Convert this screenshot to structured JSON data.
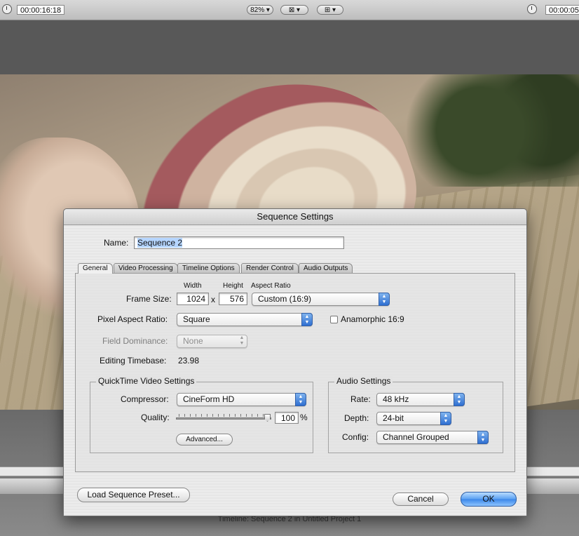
{
  "viewer": {
    "left_timecode": "00:00:16:18",
    "zoom": "82%",
    "view_menu_icon": "view-icon",
    "overlay_menu_icon": "overlay-icon",
    "right_timecode": "00:00:05"
  },
  "timeline_title": "Timeline: Sequence 2 in Untitled Project 1",
  "dialog": {
    "title": "Sequence Settings",
    "name_label": "Name:",
    "name_value": "Sequence 2",
    "tabs": [
      {
        "label": "General"
      },
      {
        "label": "Video Processing"
      },
      {
        "label": "Timeline Options"
      },
      {
        "label": "Render Control"
      },
      {
        "label": "Audio Outputs"
      }
    ],
    "frame": {
      "width_header": "Width",
      "height_header": "Height",
      "aspect_header": "Aspect Ratio",
      "label": "Frame Size:",
      "width": "1024",
      "x": "x",
      "height": "576",
      "aspect": "Custom (16:9)"
    },
    "pixel_aspect": {
      "label": "Pixel Aspect Ratio:",
      "value": "Square",
      "anamorphic_label": "Anamorphic 16:9",
      "anamorphic_checked": false
    },
    "field_dominance": {
      "label": "Field Dominance:",
      "value": "None"
    },
    "editing_timebase": {
      "label": "Editing Timebase:",
      "value": "23.98"
    },
    "qt": {
      "title": "QuickTime Video Settings",
      "compressor_label": "Compressor:",
      "compressor": "CineForm HD",
      "quality_label": "Quality:",
      "quality": "100",
      "quality_unit": "%",
      "quality_fraction": 1.0,
      "advanced": "Advanced..."
    },
    "audio": {
      "title": "Audio Settings",
      "rate_label": "Rate:",
      "rate": "48 kHz",
      "depth_label": "Depth:",
      "depth": "24-bit",
      "config_label": "Config:",
      "config": "Channel Grouped"
    },
    "load_preset": "Load Sequence Preset...",
    "cancel": "Cancel",
    "ok": "OK"
  }
}
